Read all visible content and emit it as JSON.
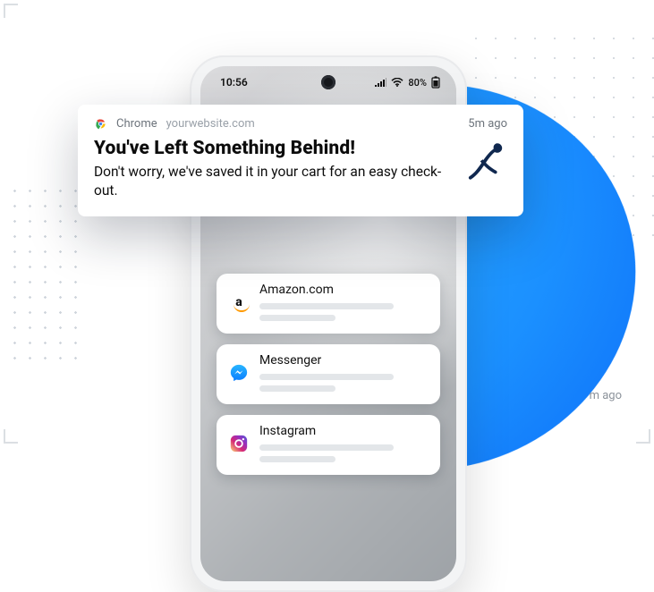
{
  "status_bar": {
    "time": "10:56",
    "signal_icon": "signal-icon",
    "wifi_icon": "wifi-icon",
    "battery_pct": "80%",
    "battery_icon": "battery-icon"
  },
  "main_notification": {
    "app_name": "Chrome",
    "site": "yourwebsite.com",
    "time_ago": "5m ago",
    "title": "You've Left Something Behind!",
    "message": "Don't worry, we've saved it in your cart for an easy check-out."
  },
  "stack": [
    {
      "icon": "amazon-icon",
      "title": "Amazon.com"
    },
    {
      "icon": "messenger-icon",
      "title": "Messenger"
    },
    {
      "icon": "instagram-icon",
      "title": "Instagram"
    }
  ],
  "peek_time": "m ago"
}
